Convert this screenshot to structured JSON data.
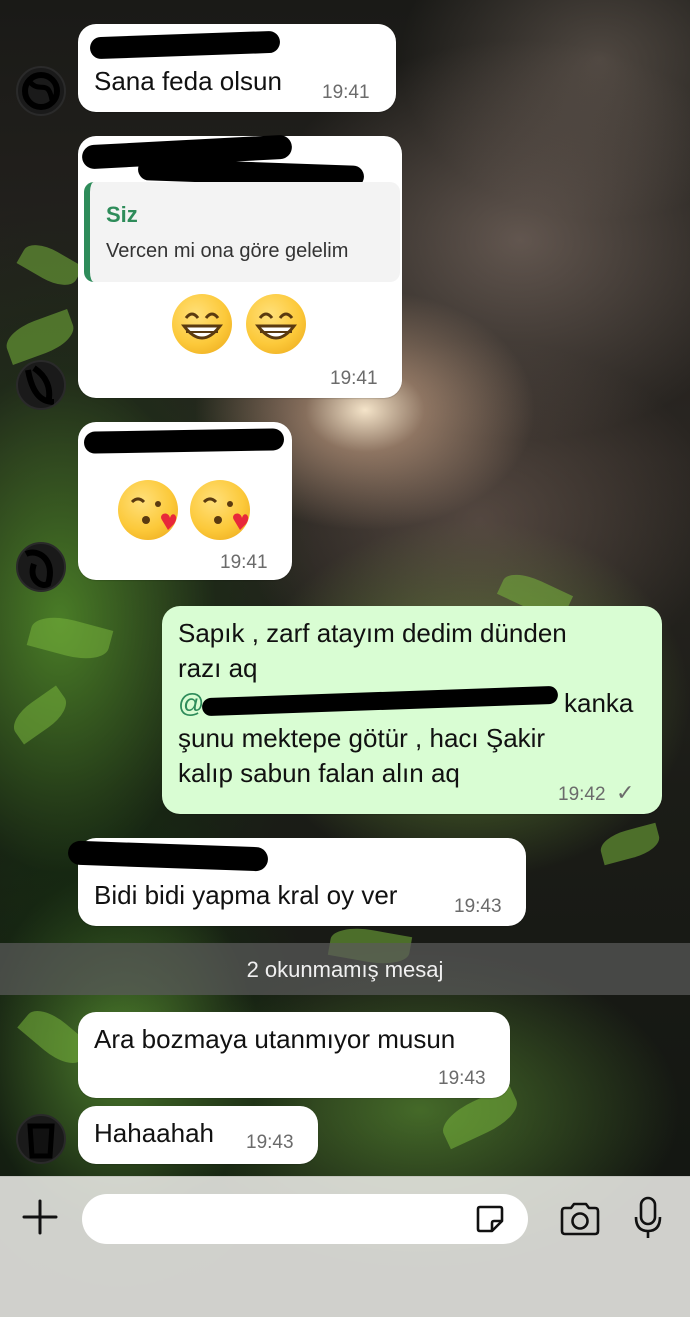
{
  "messages": [
    {
      "text": "Sana feda olsun",
      "time": "19:41"
    },
    {
      "quote_author": "Siz",
      "quote_text": "Vercen mi ona göre gelelim",
      "emoji": "😁 😁",
      "time": "19:41"
    },
    {
      "emoji": "😘 😘",
      "time": "19:41"
    },
    {
      "line1": "Sapık , zarf atayım dedim dünden",
      "line2": "razı aq",
      "mention_prefix": "@",
      "line3_tail": "kanka",
      "line4": "şunu mektepe götür , hacı Şakir",
      "line5": "kalıp sabun falan alın aq",
      "time": "19:42",
      "status": "✓"
    },
    {
      "text": "Bidi bidi yapma kral oy ver",
      "time": "19:43"
    },
    {
      "text": "Ara bozmaya utanmıyor musun",
      "time": "19:43"
    },
    {
      "text": "Hahaahah",
      "time": "19:43"
    }
  ],
  "unread_banner": "2 okunmamış mesaj",
  "colors": {
    "outgoing_bubble": "#d9fdd3",
    "incoming_bubble": "#ffffff",
    "quote_accent": "#2e8c5a"
  },
  "icons": [
    "plus-icon",
    "sticker-icon",
    "camera-icon",
    "microphone-icon"
  ]
}
